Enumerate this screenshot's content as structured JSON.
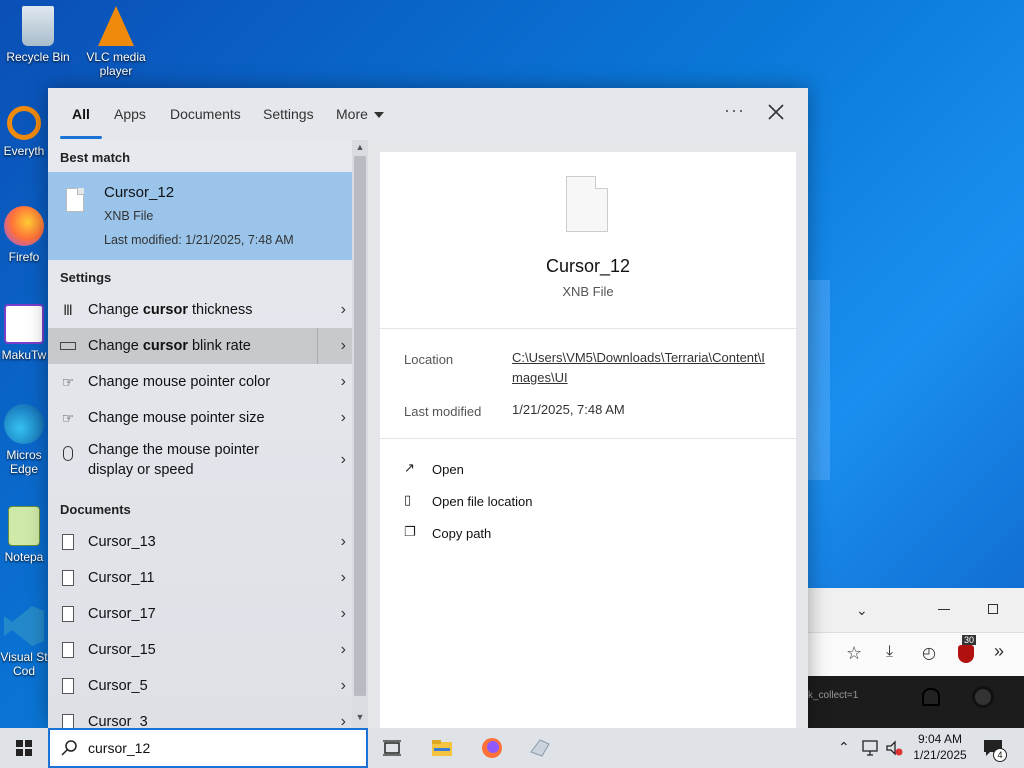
{
  "desktop": {
    "icons": [
      {
        "label": "Recycle Bin"
      },
      {
        "label": "VLC media player"
      },
      {
        "label": "Everyth"
      },
      {
        "label": "Firefo"
      },
      {
        "label": "MakuTw"
      },
      {
        "label": "Micros Edge"
      },
      {
        "label": "Notepa"
      },
      {
        "label": "Visual St Cod"
      }
    ]
  },
  "search_panel": {
    "tabs": [
      "All",
      "Apps",
      "Documents",
      "Settings",
      "More"
    ],
    "active_tab": "All",
    "sections": {
      "best_match": "Best match",
      "settings": "Settings",
      "documents": "Documents"
    },
    "best_match": {
      "name": "Cursor_12",
      "type": "XNB File",
      "modified": "Last modified: 1/21/2025, 7:48 AM"
    },
    "settings_items": [
      {
        "pre": "Change ",
        "bold": "cursor",
        "post": " thickness",
        "icon": "text-cursor-icon"
      },
      {
        "pre": "Change ",
        "bold": "cursor",
        "post": " blink rate",
        "icon": "keyboard-icon"
      },
      {
        "pre": "Change mouse pointer color",
        "bold": "",
        "post": "",
        "icon": "pointer-hand-icon"
      },
      {
        "pre": "Change mouse pointer size",
        "bold": "",
        "post": "",
        "icon": "pointer-hand-icon"
      },
      {
        "pre": "Change the mouse pointer",
        "bold": "",
        "post": "",
        "line2": "display or speed",
        "icon": "mouse-icon"
      }
    ],
    "documents": [
      "Cursor_13",
      "Cursor_11",
      "Cursor_17",
      "Cursor_15",
      "Cursor_5",
      "Cursor_3"
    ],
    "preview": {
      "name": "Cursor_12",
      "type": "XNB File",
      "location_label": "Location",
      "location_value": "C:\\Users\\VM5\\Downloads\\Terraria\\Content\\Images\\UI",
      "modified_label": "Last modified",
      "modified_value": "1/21/2025, 7:48 AM",
      "actions": [
        "Open",
        "Open file location",
        "Copy path"
      ]
    }
  },
  "taskbar": {
    "search_value": "cursor_12",
    "time": "9:04 AM",
    "date": "1/21/2025",
    "notification_count": "4"
  },
  "background_window": {
    "badge": "30",
    "tab_text": "k_collect=1"
  },
  "colors": {
    "accent": "#1a73d6",
    "best_match_bg": "#9ac4ea",
    "desktop_bg": "#0a78d8"
  }
}
